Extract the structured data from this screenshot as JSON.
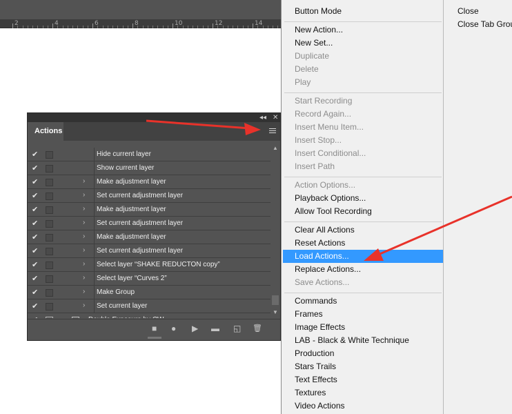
{
  "ruler": {
    "labels": [
      "2",
      "4",
      "6",
      "8",
      "10",
      "12",
      "14"
    ]
  },
  "panel": {
    "tab_label": "Actions",
    "collapse_glyph": "◂◂",
    "close_glyph": "✕",
    "rows": [
      {
        "label": "Hide current layer",
        "checked": true,
        "expandable": false
      },
      {
        "label": "Show current layer",
        "checked": true,
        "expandable": false
      },
      {
        "label": "Make adjustment layer",
        "checked": true,
        "expandable": true
      },
      {
        "label": "Set current adjustment layer",
        "checked": true,
        "expandable": true
      },
      {
        "label": "Make adjustment layer",
        "checked": true,
        "expandable": true
      },
      {
        "label": "Set current adjustment layer",
        "checked": true,
        "expandable": true
      },
      {
        "label": "Make adjustment layer",
        "checked": true,
        "expandable": true
      },
      {
        "label": "Set current adjustment layer",
        "checked": true,
        "expandable": true
      },
      {
        "label": "Select layer “SHAKE REDUCTON copy”",
        "checked": true,
        "expandable": true
      },
      {
        "label": "Select layer “Curves 2”",
        "checked": true,
        "expandable": true
      },
      {
        "label": "Make Group",
        "checked": true,
        "expandable": true
      },
      {
        "label": "Set current layer",
        "checked": true,
        "expandable": true
      },
      {
        "label": "Double Exposure by CW",
        "checked": true,
        "expandable": true,
        "folder": true
      }
    ],
    "toolbar_glyphs": {
      "stop": "■",
      "record": "●",
      "play": "▶",
      "new_set": "▬",
      "new_action": "◱",
      "delete": "🗑"
    }
  },
  "flyout_menu": {
    "groups": [
      [
        {
          "label": "Button Mode",
          "enabled": true
        }
      ],
      [
        {
          "label": "New Action...",
          "enabled": true
        },
        {
          "label": "New Set...",
          "enabled": true
        },
        {
          "label": "Duplicate",
          "enabled": false
        },
        {
          "label": "Delete",
          "enabled": false
        },
        {
          "label": "Play",
          "enabled": false
        }
      ],
      [
        {
          "label": "Start Recording",
          "enabled": false
        },
        {
          "label": "Record Again...",
          "enabled": false
        },
        {
          "label": "Insert Menu Item...",
          "enabled": false
        },
        {
          "label": "Insert Stop...",
          "enabled": false
        },
        {
          "label": "Insert Conditional...",
          "enabled": false
        },
        {
          "label": "Insert Path",
          "enabled": false
        }
      ],
      [
        {
          "label": "Action Options...",
          "enabled": false
        },
        {
          "label": "Playback Options...",
          "enabled": true
        },
        {
          "label": "Allow Tool Recording",
          "enabled": true
        }
      ],
      [
        {
          "label": "Clear All Actions",
          "enabled": true
        },
        {
          "label": "Reset Actions",
          "enabled": true
        },
        {
          "label": "Load Actions...",
          "enabled": true,
          "highlighted": true
        },
        {
          "label": "Replace Actions...",
          "enabled": true
        },
        {
          "label": "Save Actions...",
          "enabled": false
        }
      ],
      [
        {
          "label": "Commands",
          "enabled": true
        },
        {
          "label": "Frames",
          "enabled": true
        },
        {
          "label": "Image Effects",
          "enabled": true
        },
        {
          "label": "LAB - Black & White Technique",
          "enabled": true
        },
        {
          "label": "Production",
          "enabled": true
        },
        {
          "label": "Stars Trails",
          "enabled": true
        },
        {
          "label": "Text Effects",
          "enabled": true
        },
        {
          "label": "Textures",
          "enabled": true
        },
        {
          "label": "Video Actions",
          "enabled": true
        }
      ]
    ]
  },
  "secondary_menu": {
    "items": [
      {
        "label": "Close"
      },
      {
        "label": "Close Tab Group"
      }
    ]
  },
  "colors": {
    "highlight": "#3399ff",
    "annotation_arrow": "#e8322a",
    "panel_bg": "#535353"
  }
}
